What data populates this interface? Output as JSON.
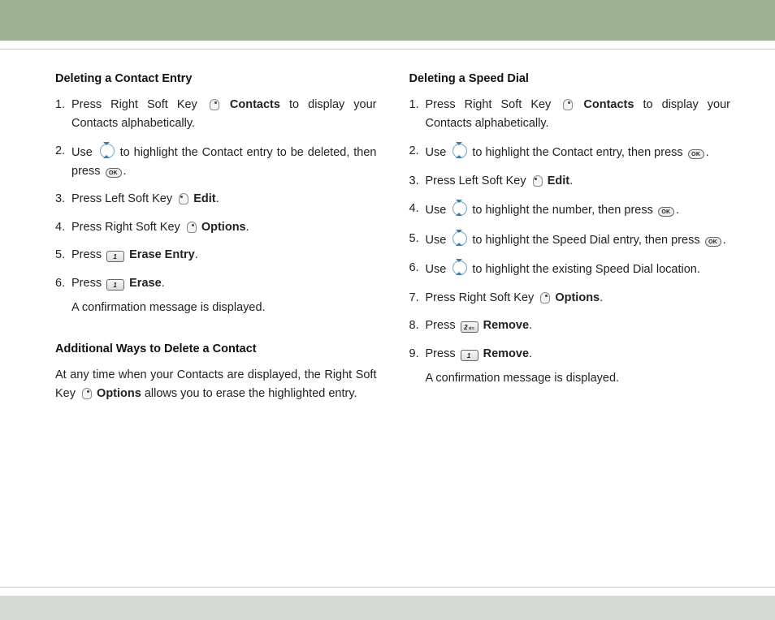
{
  "left": {
    "sec1": {
      "heading": "Deleting a Contact Entry",
      "s1a": "Press Right Soft Key ",
      "s1b": " Contacts",
      "s1c": " to display your Contacts alphabetically.",
      "s2a": "Use ",
      "s2b": " to highlight the Contact entry to be deleted, then press ",
      "s2c": ".",
      "s3a": "Press Left Soft Key ",
      "s3b": " Edit",
      "s3c": ".",
      "s4a": "Press Right Soft Key ",
      "s4b": " Options",
      "s4c": ".",
      "s5a": "Press ",
      "s5b": " Erase Entry",
      "s5c": ".",
      "s6a": "Press ",
      "s6b": " Erase",
      "s6c": ".",
      "s6note": "A confirmation message is displayed."
    },
    "sec2": {
      "heading": "Additional Ways to Delete a Contact",
      "p1a": "At any time when your Contacts are displayed, the Right Soft Key ",
      "p1b": " Options",
      "p1c": " allows you to erase the highlighted entry."
    }
  },
  "right": {
    "sec1": {
      "heading": "Deleting a Speed Dial",
      "s1a": "Press Right Soft Key ",
      "s1b": " Contacts",
      "s1c": " to display your Contacts alphabetically.",
      "s2a": "Use ",
      "s2b": " to highlight the Contact entry, then press ",
      "s2c": ".",
      "s3a": "Press Left Soft Key ",
      "s3b": " Edit",
      "s3c": ".",
      "s4a": "Use ",
      "s4b": " to highlight the number, then press ",
      "s4c": ".",
      "s5a": "Use ",
      "s5b": " to highlight the Speed Dial entry, then press ",
      "s5c": ".",
      "s6a": "Use ",
      "s6b": " to highlight the existing Speed Dial location.",
      "s7a": "Press Right Soft Key ",
      "s7b": " Options",
      "s7c": ".",
      "s8a": "Press ",
      "s8b": " Remove",
      "s8c": ".",
      "s9a": "Press ",
      "s9b": " Remove",
      "s9c": ".",
      "s9note": "A confirmation message is displayed."
    }
  },
  "icons": {
    "ok": "OK",
    "key1": "1",
    "key1sub": "",
    "key2": "2",
    "key2sub": "abc"
  }
}
